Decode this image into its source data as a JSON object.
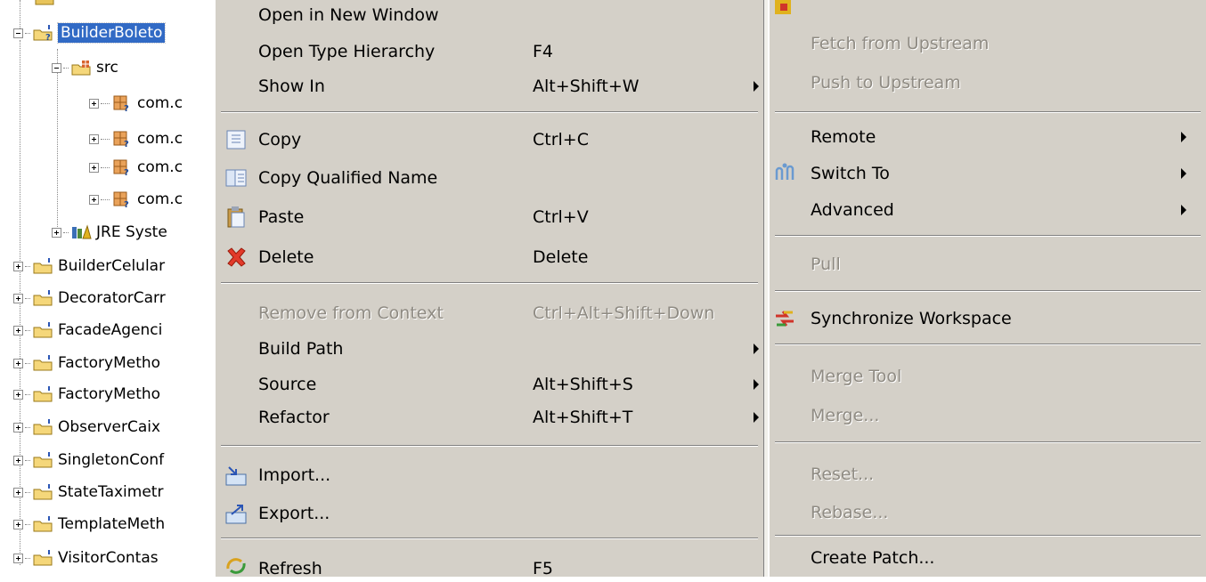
{
  "tree": {
    "project": "BuilderBoleto",
    "src": "src",
    "packages": [
      "com.c",
      "com.c",
      "com.c",
      "com.c"
    ],
    "jre": "JRE Syste",
    "projects": [
      "BuilderCelular",
      "DecoratorCarr",
      "FacadeAgenci",
      "FactoryMetho",
      "FactoryMetho",
      "ObserverCaix",
      "SingletonConf",
      "StateTaximetr",
      "TemplateMeth",
      "VisitorContas"
    ]
  },
  "menu1": {
    "open_new_window": "Open in New Window",
    "open_type_hierarchy": "Open Type Hierarchy",
    "open_type_hierarchy_shortcut": "F4",
    "show_in": "Show In",
    "show_in_shortcut": "Alt+Shift+W",
    "copy": "Copy",
    "copy_shortcut": "Ctrl+C",
    "copy_qualified_name": "Copy Qualified Name",
    "paste": "Paste",
    "paste_shortcut": "Ctrl+V",
    "delete": "Delete",
    "delete_shortcut": "Delete",
    "remove_from_context": "Remove from Context",
    "remove_from_context_shortcut": "Ctrl+Alt+Shift+Down",
    "build_path": "Build Path",
    "source": "Source",
    "source_shortcut": "Alt+Shift+S",
    "refactor": "Refactor",
    "refactor_shortcut": "Alt+Shift+T",
    "import": "Import...",
    "export": "Export...",
    "refresh": "Refresh",
    "refresh_shortcut": "F5"
  },
  "menu2": {
    "fetch_from_upstream": "Fetch from Upstream",
    "push_to_upstream": "Push to Upstream",
    "remote": "Remote",
    "switch_to": "Switch To",
    "advanced": "Advanced",
    "pull": "Pull",
    "synchronize_workspace": "Synchronize Workspace",
    "merge_tool": "Merge Tool",
    "merge": "Merge...",
    "reset": "Reset...",
    "rebase": "Rebase...",
    "create_patch": "Create Patch..."
  }
}
